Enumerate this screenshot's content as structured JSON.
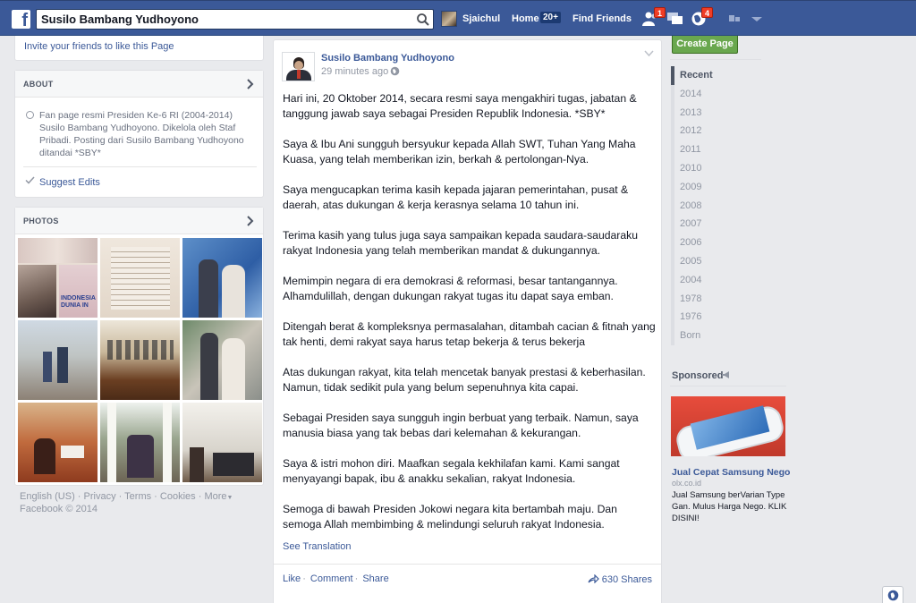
{
  "topbar": {
    "logo": "f",
    "search_value": "Susilo Bambang Yudhoyono",
    "user_name": "Sjaichul",
    "home_label": "Home",
    "home_count": "20+",
    "find_friends_label": "Find Friends",
    "friend_requests_badge": "1",
    "notifications_badge": "4",
    "colors": {
      "bar": "#3b5998",
      "badge": "#f03d25"
    }
  },
  "left": {
    "invite_link": "Invite your friends to like this Page",
    "about_header": "ABOUT",
    "about_text": "Fan page resmi Presiden Ke-6 RI (2004-2014) Susilo Bambang Yudhoyono. Dikelola oleh Staf Pribadi. Posting dari Susilo Bambang Yudhoyono ditandai *SBY*",
    "suggest_edits": "Suggest Edits",
    "photos_header": "PHOTOS",
    "photo_text_1": "INDONESIA",
    "photo_text_2": "DUNIA IN",
    "footer": {
      "english": "English (US)",
      "privacy": "Privacy",
      "terms": "Terms",
      "cookies": "Cookies",
      "more": "More",
      "copyright": "Facebook © 2014"
    }
  },
  "post": {
    "author": "Susilo Bambang Yudhoyono",
    "time": "29 minutes ago",
    "paragraphs": [
      "Hari ini, 20 Oktober 2014, secara resmi saya mengakhiri tugas, jabatan & tanggung jawab saya sebagai Presiden Republik Indonesia. *SBY*",
      "Saya & Ibu Ani sungguh bersyukur kepada Allah SWT, Tuhan Yang Maha Kuasa, yang telah memberikan izin, berkah & pertolongan-Nya.",
      "Saya mengucapkan terima kasih kepada jajaran pemerintahan, pusat & daerah, atas dukungan & kerja kerasnya selama 10 tahun ini.",
      "Terima kasih yang tulus juga saya sampaikan kepada saudara-saudaraku rakyat Indonesia yang telah memberikan mandat & dukungannya.",
      "Memimpin negara di era demokrasi & reformasi, besar tantangannya. Alhamdulillah, dengan dukungan rakyat tugas itu dapat saya emban.",
      "Ditengah berat & kompleksnya permasalahan, ditambah cacian & fitnah yang tak henti, demi rakyat saya harus tetap bekerja & terus bekerja",
      "Atas dukungan rakyat, kita telah mencetak banyak prestasi & keberhasilan. Namun, tidak sedikit pula yang belum sepenuhnya kita capai.",
      "Sebagai Presiden saya sungguh ingin berbuat yang terbaik. Namun, saya manusia biasa yang tak bebas dari kelemahan & kekurangan.",
      "Saya & istri mohon diri. Maafkan segala kekhilafan kami. Kami sangat menyayangi bapak, ibu & anakku sekalian, rakyat Indonesia.",
      "Semoga di bawah Presiden Jokowi negara kita bertambah maju. Dan semoga Allah membimbing & melindungi seluruh rakyat Indonesia."
    ],
    "see_translation": "See Translation",
    "like": "Like",
    "comment": "Comment",
    "share": "Share",
    "shares_count": "630 Shares"
  },
  "right": {
    "create_page": "Create Page",
    "timeline": [
      "Recent",
      "2014",
      "2013",
      "2012",
      "2011",
      "2010",
      "2009",
      "2008",
      "2007",
      "2006",
      "2005",
      "2004",
      "1978",
      "1976",
      "Born"
    ],
    "sponsored": "Sponsored",
    "ad_title": "Jual Cepat Samsung Nego",
    "ad_domain": "olx.co.id",
    "ad_text": "Jual Samsung berVarian Type Gan. Mulus Harga Nego. KLIK DISINI!"
  }
}
